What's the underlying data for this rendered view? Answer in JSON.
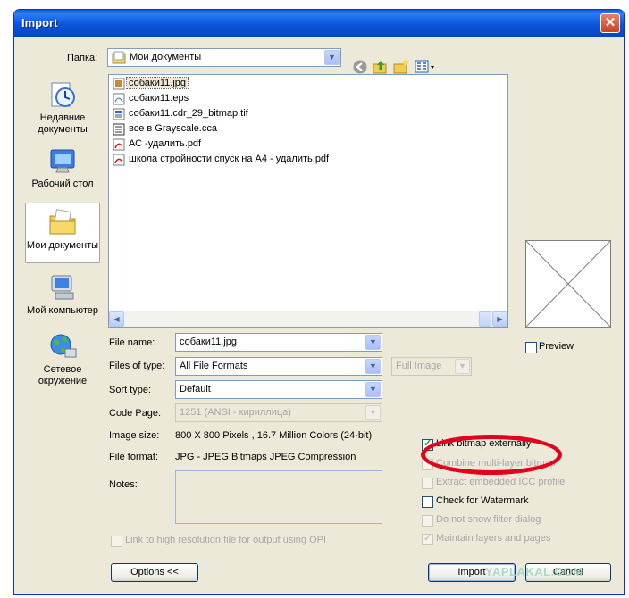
{
  "window": {
    "title": "Import",
    "close_glyph": "✕"
  },
  "folder": {
    "label": "Папка:",
    "value": "Мои документы"
  },
  "toolbar": {
    "icons": [
      "back-icon",
      "up-folder-icon",
      "new-folder-icon",
      "view-menu-icon"
    ]
  },
  "places": [
    {
      "label": "Недавние документы",
      "icon": "recent-documents-icon"
    },
    {
      "label": "Рабочий стол",
      "icon": "desktop-icon"
    },
    {
      "label": "Мои документы",
      "icon": "my-documents-icon",
      "selected": true
    },
    {
      "label": "Мой компьютер",
      "icon": "my-computer-icon"
    },
    {
      "label": "Сетевое окружение",
      "icon": "network-icon"
    }
  ],
  "files": [
    {
      "name": "собаки11.jpg",
      "icon": "jpg-file-icon",
      "selected": true
    },
    {
      "name": "собаки11.eps",
      "icon": "eps-file-icon"
    },
    {
      "name": "собаки11.cdr_29_bitmap.tif",
      "icon": "tif-file-icon"
    },
    {
      "name": "все в Grayscale.cca",
      "icon": "cca-file-icon"
    },
    {
      "name": "АС -удалить.pdf",
      "icon": "pdf-file-icon"
    },
    {
      "name": "школа стройности спуск на А4 - удалить.pdf",
      "icon": "pdf-file-icon"
    }
  ],
  "form": {
    "file_name_label": "File name:",
    "file_name_value": "собаки11.jpg",
    "files_of_type_label": "Files of type:",
    "files_of_type_value": "All File Formats",
    "full_image_value": "Full Image",
    "sort_type_label": "Sort type:",
    "sort_type_value": "Default",
    "code_page_label": "Code Page:",
    "code_page_value": "1251  (ANSI - кириллица)",
    "image_size_label": "Image size:",
    "image_size_value": "800 X 800 Pixels , 16.7 Million Colors (24-bit)",
    "file_format_label": "File format:",
    "file_format_value": "JPG - JPEG Bitmaps JPEG Compression",
    "notes_label": "Notes:"
  },
  "preview": {
    "label": "Preview",
    "checked": false
  },
  "options": {
    "link_bitmap": {
      "label": "Link bitmap externally",
      "checked": true,
      "enabled": true
    },
    "combine_layer": {
      "label": "Combine multi-layer bitmap",
      "checked": false,
      "enabled": false
    },
    "extract_icc": {
      "label": "Extract embedded ICC profile",
      "checked": false,
      "enabled": false
    },
    "watermark": {
      "label": "Check for Watermark",
      "checked": false,
      "enabled": true
    },
    "no_filter": {
      "label": "Do not show filter dialog",
      "checked": false,
      "enabled": false
    },
    "maintain_layers": {
      "label": "Maintain layers and pages",
      "checked": true,
      "enabled": false
    },
    "link_high_res": {
      "label": "Link to high resolution file for output using OPI",
      "checked": false,
      "enabled": false
    }
  },
  "buttons": {
    "options": "Options <<",
    "import": "Import",
    "cancel": "Cancel"
  },
  "overlay": {
    "watermark_text": "YAPLAKAL.COM",
    "annotation_color": "#e3001b"
  }
}
